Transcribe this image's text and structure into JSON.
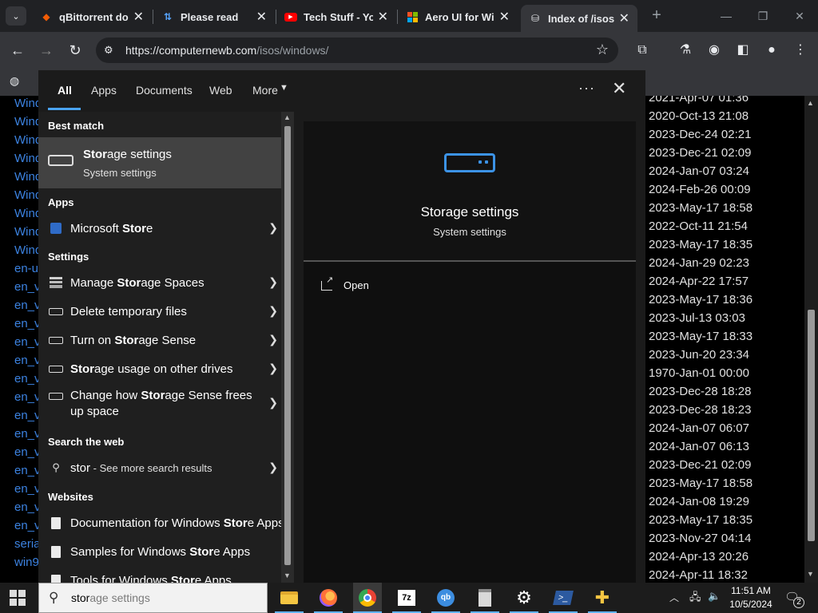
{
  "browser": {
    "tabs": [
      {
        "label": "qBittorrent do",
        "icon": "qbittorrent-icon",
        "color": "#f25c05"
      },
      {
        "label": "Please read",
        "icon": "github-pr-icon",
        "color": "#58a6ff"
      },
      {
        "label": "Tech Stuff - Yo",
        "icon": "youtube-icon",
        "color": "#ff0000"
      },
      {
        "label": "Aero UI for Wi",
        "icon": "windows-logo-icon",
        "color": "#f2c811"
      },
      {
        "label": "Index of /isos/v",
        "icon": "folder-icon",
        "color": "#e8eaed"
      }
    ],
    "url_host": "https://computernewb.com",
    "url_path": "/isos/windows/"
  },
  "page": {
    "left_fragments": [
      "Wind",
      "Wind",
      "Wind",
      "Wind",
      "Wind",
      "Wind",
      "Wind",
      "Wind",
      "Wind",
      "en-u",
      "en_v",
      "en_v",
      "en_v",
      "en_v",
      "en_v",
      "en_v",
      "en_v",
      "en_v",
      "en_v",
      "en_v",
      "en_v",
      "en_v",
      "en_v",
      "en_v",
      "seria",
      "win9"
    ],
    "dates": [
      "2021-Apr-07 01:36",
      "2020-Oct-13 21:08",
      "2023-Dec-24 02:21",
      "2023-Dec-21 02:09",
      "2024-Jan-07 03:24",
      "2024-Feb-26 00:09",
      "2023-May-17 18:58",
      "2022-Oct-11 21:54",
      "2023-May-17 18:35",
      "2024-Jan-29 02:23",
      "2024-Apr-22 17:57",
      "2023-May-17 18:36",
      "2023-Jul-13 03:03",
      "2023-May-17 18:33",
      "2023-Jun-20 23:34",
      "1970-Jan-01 00:00",
      "2023-Dec-28 18:28",
      "2023-Dec-28 18:23",
      "2024-Jan-07 06:07",
      "2024-Jan-07 06:13",
      "2023-Dec-21 02:09",
      "2023-May-17 18:58",
      "2024-Jan-08 19:29",
      "2023-May-17 18:35",
      "2023-Nov-27 04:14",
      "2024-Apr-13 20:26",
      "2024-Apr-11 18:32"
    ]
  },
  "search": {
    "filters": {
      "all": "All",
      "apps": "Apps",
      "documents": "Documents",
      "web": "Web",
      "more": "More"
    },
    "best_match_heading": "Best match",
    "best_match": {
      "title_bold": "Stor",
      "title_rest": "age settings",
      "subtitle": "System settings"
    },
    "apps_heading": "Apps",
    "apps": [
      {
        "pre": "Microsoft ",
        "bold": "Stor",
        "post": "e"
      }
    ],
    "settings_heading": "Settings",
    "settings": [
      {
        "pre": "Manage ",
        "bold": "Stor",
        "post": "age Spaces"
      },
      {
        "pre": "Delete temporary files",
        "bold": "",
        "post": ""
      },
      {
        "pre": "Turn on ",
        "bold": "Stor",
        "post": "age Sense"
      },
      {
        "pre": "",
        "bold": "Stor",
        "post": "age usage on other drives"
      },
      {
        "pre": "Change how ",
        "bold": "Stor",
        "post": "age Sense frees",
        "line2": "up space"
      }
    ],
    "web_heading": "Search the web",
    "web_query": "stor",
    "web_suffix": " - See more search results",
    "websites_heading": "Websites",
    "websites": [
      {
        "pre": "Documentation for Windows ",
        "bold": "Stor",
        "post": "e Apps"
      },
      {
        "pre": "Samples for Windows ",
        "bold": "Stor",
        "post": "e Apps"
      },
      {
        "pre": "Tools for Windows ",
        "bold": "Stor",
        "post": "e Apps"
      }
    ],
    "preview": {
      "title": "Storage settings",
      "subtitle": "System settings",
      "action": "Open"
    }
  },
  "taskbar": {
    "search_typed": "stor",
    "search_ghost": "age settings",
    "time": "11:51 AM",
    "date": "10/5/2024",
    "notifications": "2"
  }
}
